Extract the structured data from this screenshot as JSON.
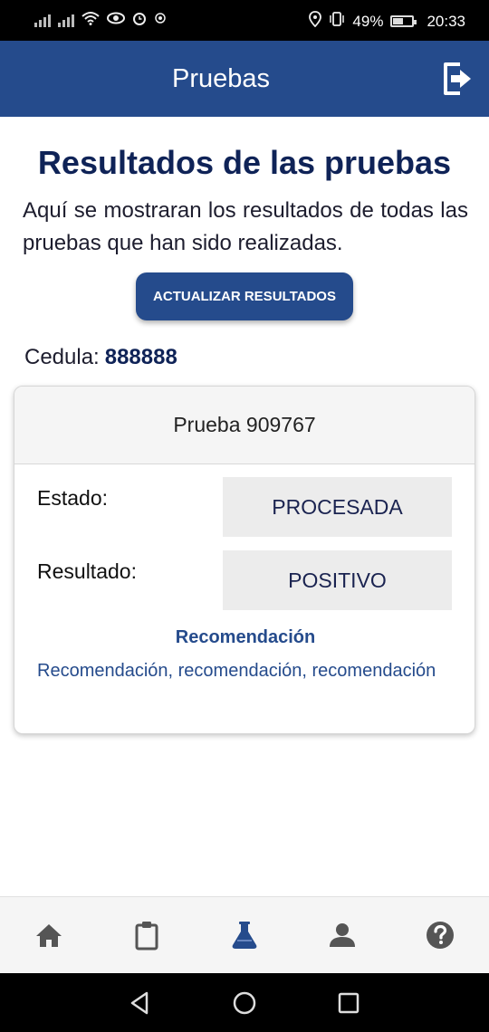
{
  "status_bar": {
    "battery": "49%",
    "time": "20:33",
    "icons": [
      "signal-icon",
      "wifi-icon",
      "eye-icon",
      "alarm-icon",
      "location-icon",
      "vibrate-icon",
      "battery-icon"
    ]
  },
  "app_bar": {
    "title": "Pruebas",
    "action_icon": "logout-icon"
  },
  "main": {
    "heading": "Resultados de las pruebas",
    "intro": "Aquí se mostraran los resultados de todas las pruebas que han sido realizadas.",
    "refresh_button": "ACTUALIZAR RESULTADOS",
    "cedula_label": "Cedula:",
    "cedula_value": "888888"
  },
  "result_card": {
    "title": "Prueba 909767",
    "estado_label": "Estado:",
    "estado_value": "PROCESADA",
    "resultado_label": "Resultado:",
    "resultado_value": "POSITIVO",
    "recomendacion_title": "Recomendación",
    "recomendacion_text": "Recomendación, recomendación, recomendación"
  },
  "tab_bar": {
    "tabs": [
      {
        "icon": "home-icon",
        "active": false
      },
      {
        "icon": "clipboard-icon",
        "active": false
      },
      {
        "icon": "flask-icon",
        "active": true
      },
      {
        "icon": "user-icon",
        "active": false
      },
      {
        "icon": "help-icon",
        "active": false
      }
    ],
    "active_color": "#254b8c",
    "inactive_color": "#555555"
  },
  "colors": {
    "primary": "#254b8c",
    "heading": "#0f2357"
  }
}
